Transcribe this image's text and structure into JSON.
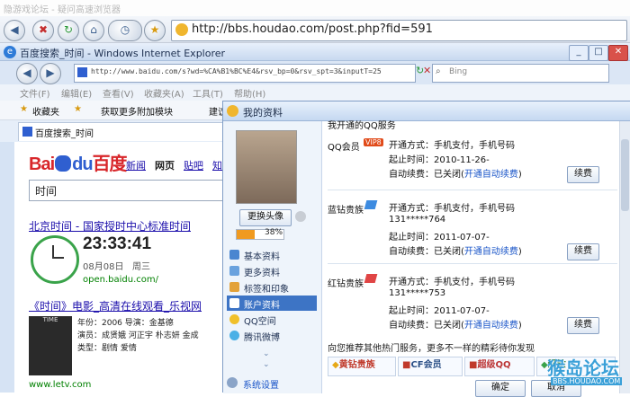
{
  "outer": {
    "title": "隐游戏论坛 - 疑问高速浏览器",
    "address": "http://bbs.houdao.com/post.php?fid=591"
  },
  "ie": {
    "title": "百度搜索_时间 - Windows Internet Explorer",
    "address": "http://www.baidu.com/s?wd=%CA%B1%BC%E4&rsv_bp=0&rsv_spt=3&inputT=25",
    "search_placeholder": "Bing",
    "menu": [
      "文件(F)",
      "编辑(E)",
      "查看(V)",
      "收藏夹(A)",
      "工具(T)",
      "帮助(H)"
    ],
    "fav_label": "收藏夹",
    "fav_items": [
      "获取更多附加模块",
      "建议网"
    ],
    "tab_title": "百度搜索_时间"
  },
  "baidu": {
    "logo_left": "Bai",
    "logo_du": "du",
    "logo_right": "百度",
    "nav": [
      "新闻",
      "网页",
      "贴吧",
      "知"
    ],
    "query": "时间",
    "result1_title": "北京时间 - 国家授时中心标准时间",
    "clock_time": "23:33:41",
    "clock_date": "08月08日   周三",
    "clock_source": "open.baidu.com/",
    "result2_title": "《时间》电影_高清在线观看_乐视网",
    "result2_year": "年份：2006   导演：金基德",
    "result2_cast": "演员：成贤娥  河正宇  朴志妍  金成",
    "result2_type": "类型：剧情  爱情",
    "result2_source": "www.letv.com",
    "poster_text": "TIME"
  },
  "dialog": {
    "title": "我的资料",
    "change_avatar": "更换头像",
    "progress_label": "38%",
    "progress_value": 0.38,
    "sidebar": [
      "基本资料",
      "更多资料",
      "标签和印象",
      "账户资料",
      "QQ空间",
      "腾讯微博"
    ],
    "settings": "系统设置",
    "section_header": "我开通的QQ服务",
    "services": [
      {
        "name": "QQ会员",
        "badge": "VIP8",
        "method": "开通方式：手机支付，手机号码",
        "number": "",
        "start": "起止时间：2010-11-26-",
        "renew_prefix": "自动续费：已关闭(",
        "renew_link": "开通自动续费",
        "renew_suffix": ")",
        "button": "续费"
      },
      {
        "name": "蓝钻贵族",
        "badge": "",
        "method": "开通方式：手机支付，手机号码",
        "number": "131*****764",
        "start": "起止时间：2011-07-07-",
        "renew_prefix": "自动续费：已关闭(",
        "renew_link": "开通自动续费",
        "renew_suffix": ")",
        "button": "续费"
      },
      {
        "name": "红钻贵族",
        "badge": "",
        "method": "开通方式：手机支付，手机号码",
        "number": "131*****753",
        "start": "起止时间：2011-07-07-",
        "renew_prefix": "自动续费：已关闭(",
        "renew_link": "开通自动续费",
        "renew_suffix": ")",
        "button": "续费"
      }
    ],
    "recommend": "向您推荐其他热门服务，更多不一样的精彩待你发现",
    "hot_services": [
      "黄钻贵族",
      "CF会员",
      "超级QQ",
      "绿钻"
    ],
    "ok_button": "确定",
    "cancel_button": "取消"
  },
  "watermark": {
    "line1": "猴岛论坛",
    "line2": "BBS.HOUDAO.COM"
  },
  "colors": {
    "accent": "#3d74c5",
    "link": "#1a0dab",
    "red": "#d8262a"
  }
}
